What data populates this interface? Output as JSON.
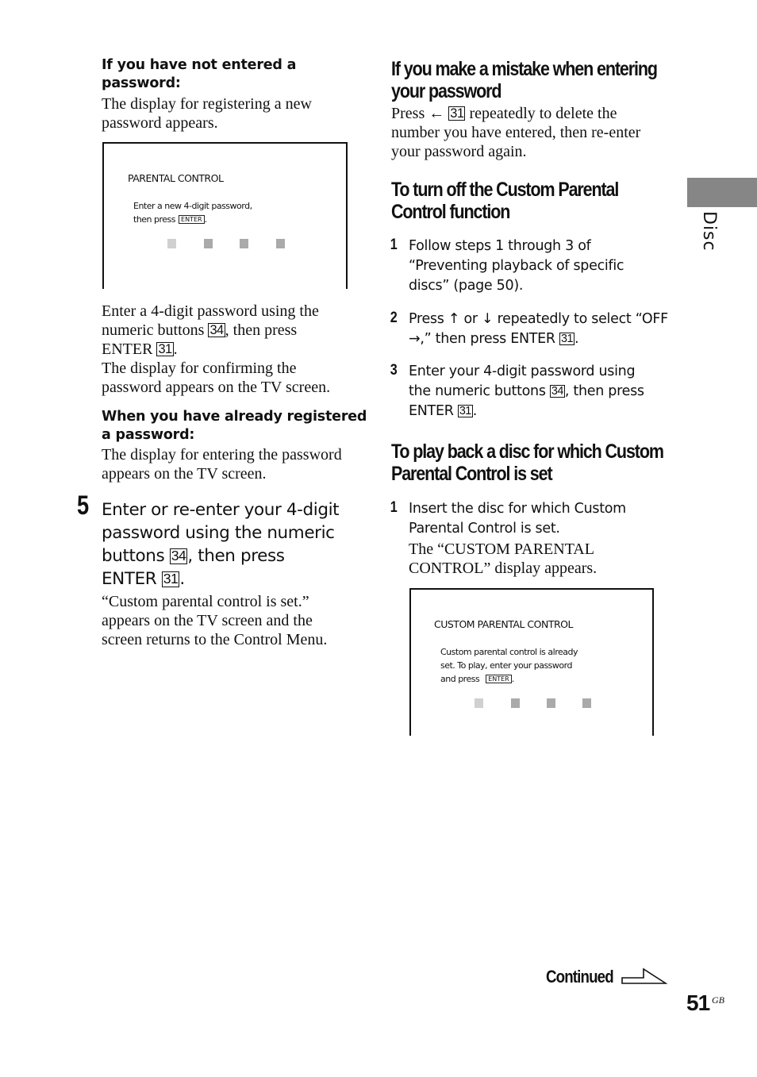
{
  "left_column": {
    "not_entered": {
      "heading": "If you have not entered a password:",
      "heading_lines": [
        "If you have not entered a",
        "password:"
      ],
      "text_lines": [
        "The display for registering a new",
        "password appears."
      ]
    },
    "screen1": {
      "title": "PARENTAL CONTROL",
      "line1": "Enter a new 4-digit password,",
      "line2": "then press",
      "enter_key": "ENTER",
      "line2_end": ".",
      "password_slots": 4
    },
    "after_screen1": {
      "line1": "Enter a 4-digit password using the",
      "line2_pre": "numeric buttons ",
      "ref_numeric": "34",
      "line2_post": ", then press",
      "line3_pre": "ENTER ",
      "ref_enter": "31",
      "line3_post": ".",
      "line4": "The display for confirming the",
      "line5": "password appears on the TV screen."
    },
    "already_registered": {
      "heading_lines": [
        "When you have already registered",
        "a password:"
      ],
      "text_lines": [
        "The display for entering the password",
        "appears on the TV screen."
      ]
    },
    "step5": {
      "number": "5",
      "line1": "Enter or re-enter your 4-digit",
      "line2": "password using the numeric",
      "line3_pre": "buttons ",
      "ref_numeric": "34",
      "line3_post": ", then press",
      "line4_pre": "ENTER ",
      "ref_enter": "31",
      "line4_post": ".",
      "result_lines": [
        "“Custom parental control is set.”",
        "appears on the TV screen and the",
        "screen returns to the Control Menu."
      ]
    }
  },
  "right_column": {
    "mistake": {
      "heading_lines": [
        "If you make a mistake when entering",
        "your password"
      ],
      "line1_pre": "Press ← ",
      "ref": "31",
      "line1_post": " repeatedly to delete the",
      "line2": "number you have entered, then re-enter",
      "line3": "your password again."
    },
    "turn_off": {
      "heading_lines": [
        "To turn off the Custom Parental",
        "Control function"
      ],
      "steps": [
        {
          "number": "1",
          "lines": [
            "Follow steps 1 through 3 of",
            "“Preventing playback of specific",
            "discs” (page 50)."
          ]
        },
        {
          "number": "2",
          "line1": "Press ↑ or ↓ repeatedly to select “OFF",
          "line2_pre": "→,” then press ENTER ",
          "ref": "31",
          "line2_post": "."
        },
        {
          "number": "3",
          "line1": "Enter your 4-digit password using",
          "line2_pre": "the numeric buttons ",
          "ref_numeric": "34",
          "line2_post": ", then press",
          "line3_pre": "ENTER ",
          "ref_enter": "31",
          "line3_post": "."
        }
      ]
    },
    "play_back": {
      "heading_lines": [
        "To play back a disc for which Custom",
        "Parental Control is set"
      ],
      "step1": {
        "number": "1",
        "lines": [
          "Insert the disc for which Custom",
          "Parental Control is set."
        ],
        "result_lines": [
          "The “CUSTOM PARENTAL",
          "CONTROL” display appears."
        ]
      }
    },
    "screen2": {
      "title": "CUSTOM PARENTAL CONTROL",
      "line1": "Custom parental control is already",
      "line2": "set. To play, enter your password",
      "line3": "and press",
      "enter_key": "ENTER",
      "line3_end": ".",
      "password_slots": 4
    }
  },
  "side_tab": {
    "label": "Disc",
    "color": "#868686"
  },
  "footer": {
    "continued": "Continued",
    "page_number": "51",
    "page_suffix": "GB"
  }
}
